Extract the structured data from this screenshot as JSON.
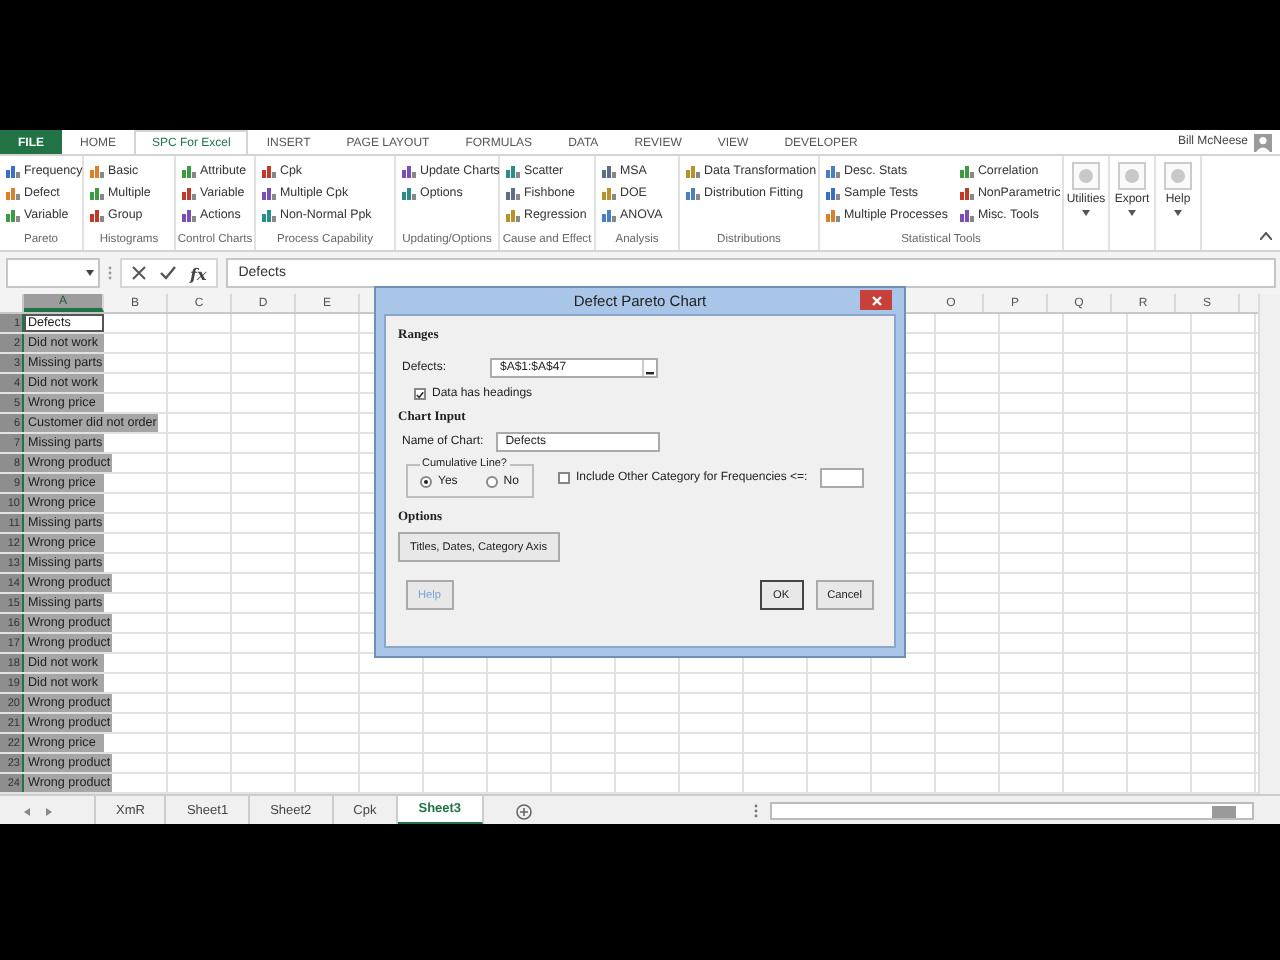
{
  "ribbon": {
    "tabs": [
      {
        "label": "FILE",
        "selected": false,
        "kind": "file"
      },
      {
        "label": "HOME",
        "selected": false,
        "kind": "tab"
      },
      {
        "label": "SPC For Excel",
        "selected": true,
        "kind": "tab"
      },
      {
        "label": "INSERT",
        "selected": false,
        "kind": "tab"
      },
      {
        "label": "PAGE LAYOUT",
        "selected": false,
        "kind": "tab"
      },
      {
        "label": "FORMULAS",
        "selected": false,
        "kind": "tab"
      },
      {
        "label": "DATA",
        "selected": false,
        "kind": "tab"
      },
      {
        "label": "REVIEW",
        "selected": false,
        "kind": "tab"
      },
      {
        "label": "VIEW",
        "selected": false,
        "kind": "tab"
      },
      {
        "label": "DEVELOPER",
        "selected": false,
        "kind": "tab"
      }
    ],
    "user": "Bill McNeese",
    "groups": [
      {
        "label": "Pareto",
        "items": [
          "Frequency",
          "Defect",
          "Variable"
        ]
      },
      {
        "label": "Histograms",
        "items": [
          "Basic",
          "Multiple",
          "Group"
        ]
      },
      {
        "label": "Control Charts",
        "items": [
          "Attribute",
          "Variable",
          "Actions"
        ]
      },
      {
        "label": "Process Capability",
        "items": [
          "Cpk",
          "Multiple Cpk",
          "Non-Normal Ppk"
        ]
      },
      {
        "label": "Updating/Options",
        "items": [
          "Update Charts",
          "Options"
        ]
      },
      {
        "label": "Cause and Effect",
        "items": [
          "Scatter",
          "Fishbone",
          "Regression"
        ]
      },
      {
        "label": "Analysis",
        "items": [
          "MSA",
          "DOE",
          "ANOVA"
        ]
      },
      {
        "label": "Distributions",
        "items": [
          "Data Transformation",
          "Distribution Fitting"
        ]
      },
      {
        "label": "Statistical Tools",
        "items": [
          "Desc. Stats",
          "Sample Tests",
          "Multiple Processes",
          "Correlation",
          "NonParametric",
          "Misc. Tools"
        ]
      }
    ],
    "large_buttons": [
      "Utilities",
      "Export",
      "Help"
    ]
  },
  "formula_bar": {
    "fx": "fx",
    "formula": "Defects"
  },
  "sheet": {
    "columns_left": [
      {
        "label": "A",
        "selected": true
      },
      {
        "label": "B",
        "selected": false
      },
      {
        "label": "C",
        "selected": false
      },
      {
        "label": "D",
        "selected": false
      },
      {
        "label": "E",
        "selected": false
      }
    ],
    "columns_right": [
      {
        "label": "O",
        "selected": false
      },
      {
        "label": "P",
        "selected": false
      },
      {
        "label": "Q",
        "selected": false
      },
      {
        "label": "R",
        "selected": false
      },
      {
        "label": "S",
        "selected": false
      }
    ],
    "rows": [
      {
        "number": "1",
        "value": "Defects",
        "active": true
      },
      {
        "number": "2",
        "value": "Did not work",
        "active": false
      },
      {
        "number": "3",
        "value": "Missing parts",
        "active": false
      },
      {
        "number": "4",
        "value": "Did not work",
        "active": false
      },
      {
        "number": "5",
        "value": "Wrong price",
        "active": false
      },
      {
        "number": "6",
        "value": "Customer did not order",
        "active": false
      },
      {
        "number": "7",
        "value": "Missing parts",
        "active": false
      },
      {
        "number": "8",
        "value": "Wrong product",
        "active": false
      },
      {
        "number": "9",
        "value": "Wrong price",
        "active": false
      },
      {
        "number": "10",
        "value": "Wrong price",
        "active": false
      },
      {
        "number": "11",
        "value": "Missing parts",
        "active": false
      },
      {
        "number": "12",
        "value": "Wrong price",
        "active": false
      },
      {
        "number": "13",
        "value": "Missing parts",
        "active": false
      },
      {
        "number": "14",
        "value": "Wrong product",
        "active": false
      },
      {
        "number": "15",
        "value": "Missing parts",
        "active": false
      },
      {
        "number": "16",
        "value": "Wrong product",
        "active": false
      },
      {
        "number": "17",
        "value": "Wrong product",
        "active": false
      },
      {
        "number": "18",
        "value": "Did not work",
        "active": false
      },
      {
        "number": "19",
        "value": "Did not work",
        "active": false
      },
      {
        "number": "20",
        "value": "Wrong product",
        "active": false
      },
      {
        "number": "21",
        "value": "Wrong product",
        "active": false
      },
      {
        "number": "22",
        "value": "Wrong price",
        "active": false
      },
      {
        "number": "23",
        "value": "Wrong product",
        "active": false
      },
      {
        "number": "24",
        "value": "Wrong product",
        "active": false
      }
    ]
  },
  "dialog": {
    "title": "Defect Pareto Chart",
    "ranges_heading": "Ranges",
    "defects_label": "Defects:",
    "defects_value": "$A$1:$A$47",
    "headings_checkbox": {
      "label": "Data has headings",
      "checked": true
    },
    "chart_input_heading": "Chart Input",
    "name_label": "Name of Chart:",
    "name_value": "Defects",
    "cumulative": {
      "legend": "Cumulative Line?",
      "options": [
        {
          "label": "Yes",
          "selected": true
        },
        {
          "label": "No",
          "selected": false
        }
      ]
    },
    "other_category": {
      "label": "Include Other Category for Frequencies <=:",
      "checked": false
    },
    "options_heading": "Options",
    "titles_button": "Titles, Dates, Category Axis",
    "buttons": [
      {
        "label": "Help",
        "disabled": true,
        "default": false
      },
      {
        "label": "OK",
        "disabled": false,
        "default": true
      },
      {
        "label": "Cancel",
        "disabled": false,
        "default": false
      }
    ]
  },
  "sheet_tabs": [
    {
      "label": "XmR",
      "selected": false
    },
    {
      "label": "Sheet1",
      "selected": false
    },
    {
      "label": "Sheet2",
      "selected": false
    },
    {
      "label": "Cpk",
      "selected": false
    },
    {
      "label": "Sheet3",
      "selected": true
    }
  ]
}
